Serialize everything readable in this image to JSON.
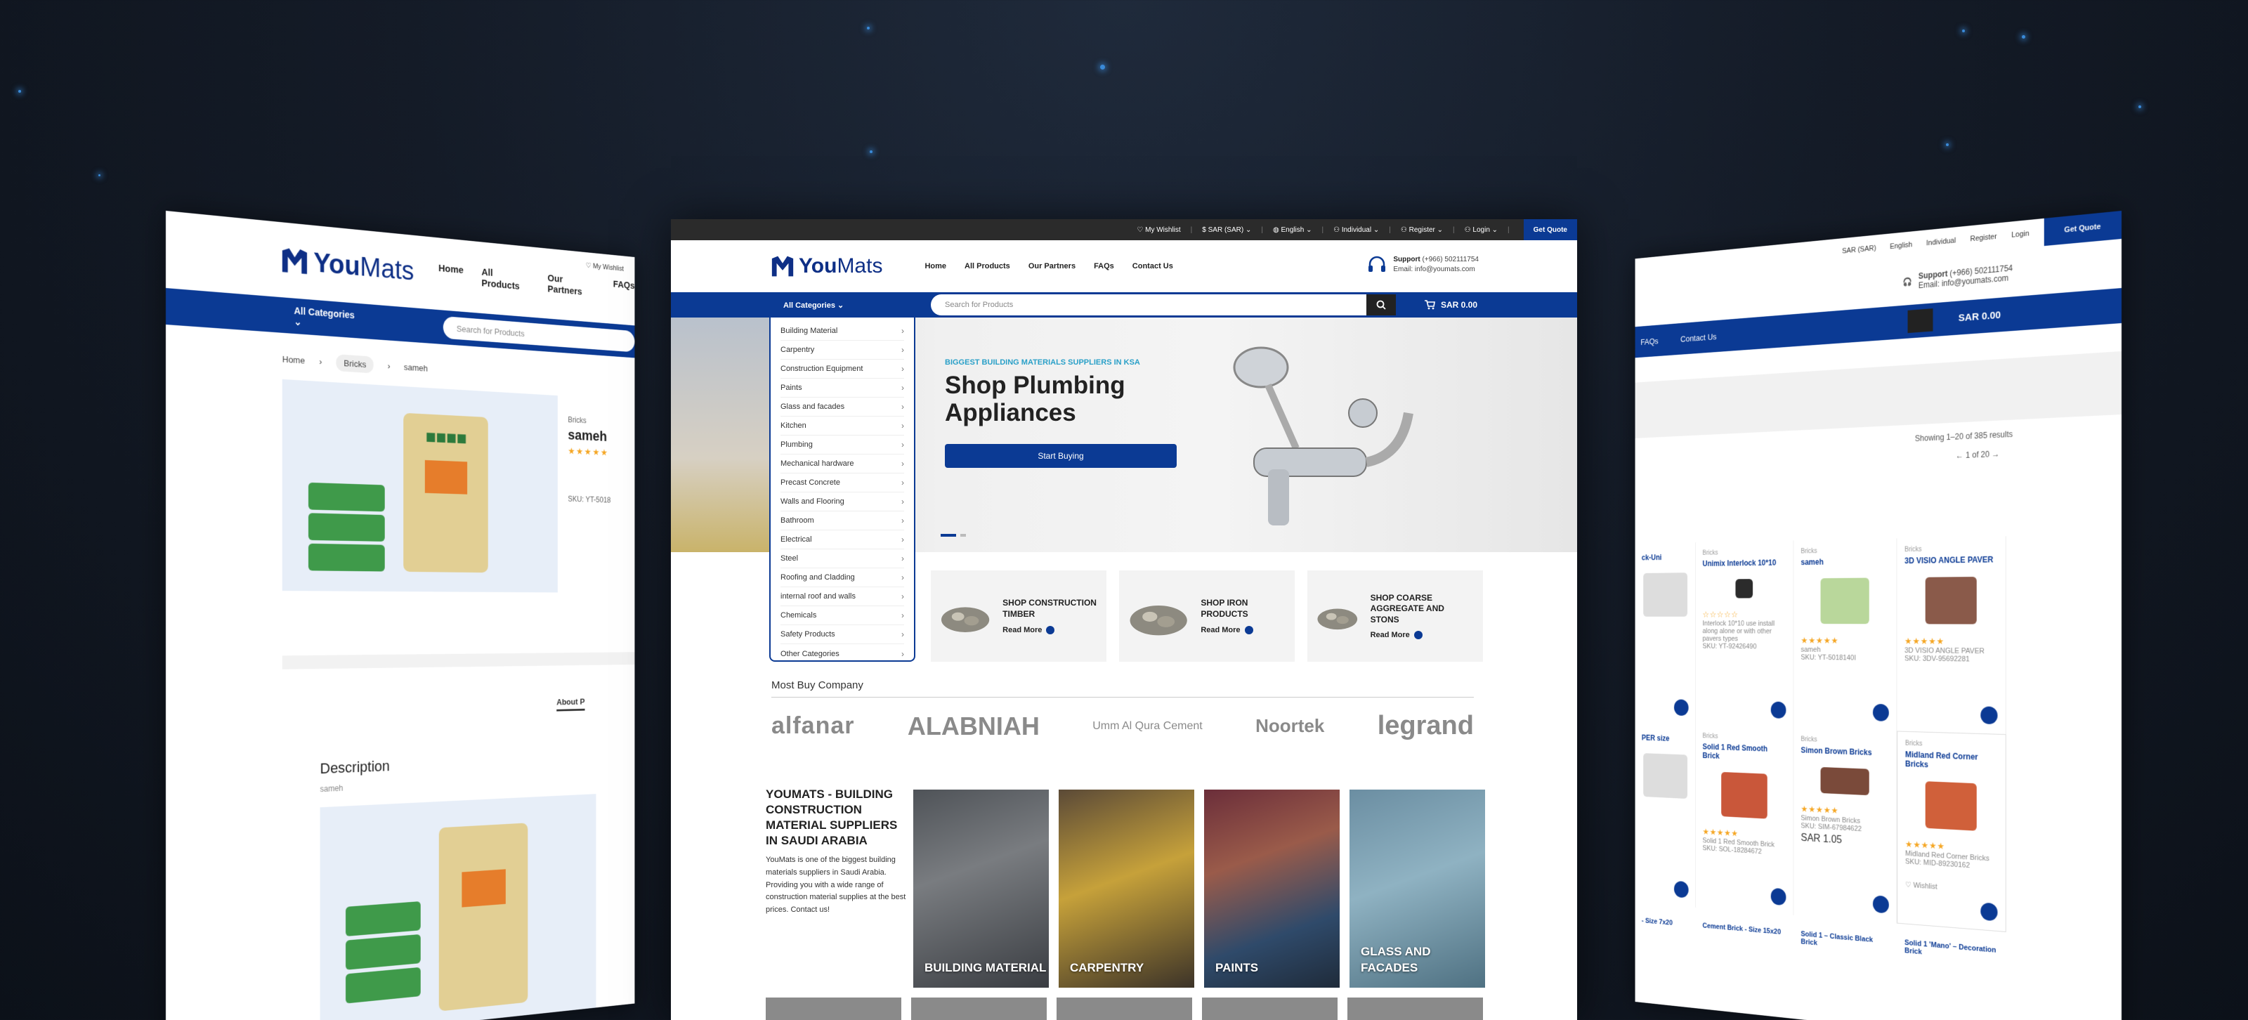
{
  "colors": {
    "brand": "#0b3a94",
    "accent_cyan": "#2aa0c8",
    "star": "#f5a623"
  },
  "brand": {
    "you": "You",
    "mats": "Mats"
  },
  "topbar": {
    "wishlist": "My Wishlist",
    "currency": "SAR (SAR)",
    "language": "English",
    "account_type": "Individual",
    "register": "Register",
    "login": "Login",
    "quote": "Get Quote"
  },
  "nav": [
    "Home",
    "All Products",
    "Our Partners",
    "FAQs",
    "Contact Us"
  ],
  "support": {
    "label": "Support",
    "phone": "(+966) 502111754",
    "email": "Email: info@youmats.com"
  },
  "bar": {
    "all_categories": "All Categories",
    "search_placeholder": "Search for Products",
    "cart": "SAR 0.00"
  },
  "categories": [
    "Building Material",
    "Carpentry",
    "Construction Equipment",
    "Paints",
    "Glass and facades",
    "Kitchen",
    "Plumbing",
    "Mechanical hardware",
    "Precast Concrete",
    "Walls and Flooring",
    "Bathroom",
    "Electrical",
    "Steel",
    "Roofing and Cladding",
    "internal roof and walls",
    "Chemicals",
    "Safety Products",
    "Other Categories"
  ],
  "hero": {
    "subtitle": "BIGGEST BUILDING MATERIALS SUPPLIERS IN KSA",
    "title": "Shop Plumbing Appliances",
    "button": "Start Buying"
  },
  "promos": [
    {
      "title": "SHOP CONSTRUCTION TIMBER",
      "link": "Read More"
    },
    {
      "title": "SHOP IRON PRODUCTS",
      "link": "Read More"
    },
    {
      "title": "SHOP COARSE AGGREGATE AND STONS",
      "link": "Read More"
    }
  ],
  "most_buy": {
    "title": "Most Buy Company",
    "brands": [
      "alfanar",
      "ALABNIAH",
      "Umm Al Qura Cement",
      "Noortek",
      "legrand"
    ]
  },
  "about": {
    "title": "YOUMATS - BUILDING CONSTRUCTION MATERIAL SUPPLIERS IN SAUDI ARABIA",
    "text": "YouMats is one of the biggest building materials suppliers in Saudi Arabia. Providing you with a wide range of construction material supplies at the best prices. Contact us!"
  },
  "tiles": [
    "BUILDING MATERIAL",
    "CARPENTRY",
    "PAINTS",
    "GLASS AND FACADES"
  ],
  "left": {
    "nav": [
      "Home",
      "All Products",
      "Our Partners",
      "FAQs"
    ],
    "wishlist": "My Wishlist",
    "crumbs": [
      "Home",
      "Bricks",
      "sameh"
    ],
    "product_cat": "Bricks",
    "product_name": "sameh",
    "sku": "SKU: YT-5018",
    "about_tab": "About P",
    "desc_title": "Description",
    "desc_text": "sameh"
  },
  "right": {
    "top": [
      "SAR (SAR)",
      "English",
      "Individual",
      "Register",
      "Login"
    ],
    "quote": "Get Quote",
    "nav": [
      "FAQs",
      "Contact Us"
    ],
    "results": "Showing 1–20 of 385 results",
    "pagination": "1 of 20",
    "products": [
      {
        "cat": "",
        "title": "ck-Uni",
        "desc": "",
        "sku": ""
      },
      {
        "cat": "Bricks",
        "title": "Unimix Interlock 10*10",
        "desc": "Interlock 10*10 use install along alone or with other pavers types",
        "sku": "SKU: YT-92426490"
      },
      {
        "cat": "Bricks",
        "title": "sameh",
        "desc": "sameh",
        "sku": "SKU: YT-5018140I"
      },
      {
        "cat": "Bricks",
        "title": "3D VISIO ANGLE PAVER",
        "desc": "3D VISIO ANGLE PAVER",
        "sku": "SKU: 3DV-95692281"
      },
      {
        "cat": "",
        "title": "PER size",
        "desc": "",
        "sku": ""
      },
      {
        "cat": "Bricks",
        "title": "Solid 1 Red Smooth Brick",
        "desc": "Solid 1 Red Smooth Brick",
        "sku": "SKU: SOL-18284672"
      },
      {
        "cat": "Bricks",
        "title": "Simon Brown Bricks",
        "desc": "Simon Brown Bricks",
        "sku": "SKU: SIM-67984622",
        "price": "SAR 1.05"
      },
      {
        "cat": "Bricks",
        "title": "Midland Red Corner Bricks",
        "desc": "Midland Red Corner Bricks",
        "sku": "SKU: MID-89230162"
      }
    ],
    "bottom": [
      "- Size 7x20",
      "Cement Brick - Size 15x20",
      "Solid 1 – Classic Black Brick",
      "Solid 1 'Mano' – Decoration Brick"
    ],
    "wishlist": "Wishlist"
  }
}
